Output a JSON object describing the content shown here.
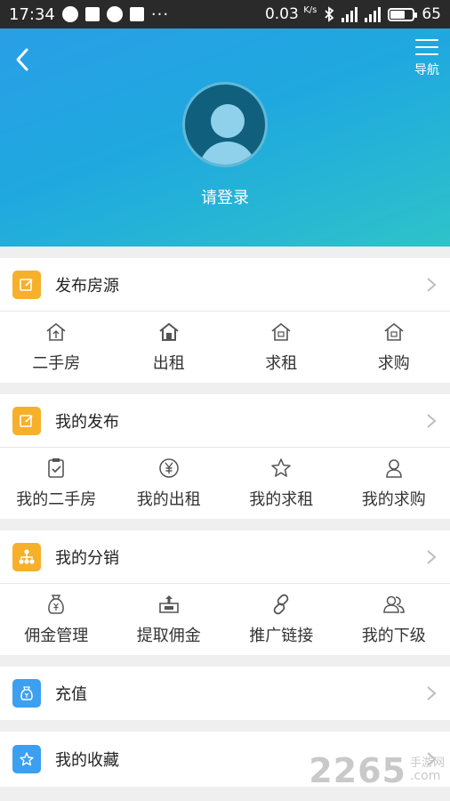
{
  "status_bar": {
    "time": "17:34",
    "speed": "0.03",
    "speed_unit": "K/s",
    "battery": "65",
    "dots": "···"
  },
  "header": {
    "nav_label": "导航",
    "login_label": "请登录"
  },
  "sections": {
    "publish": {
      "title": "发布房源",
      "items": [
        {
          "label": "二手房",
          "icon": "house-up-icon"
        },
        {
          "label": "出租",
          "icon": "house-rent-icon"
        },
        {
          "label": "求租",
          "icon": "house-seek-rent-icon"
        },
        {
          "label": "求购",
          "icon": "house-seek-buy-icon"
        }
      ]
    },
    "my_posts": {
      "title": "我的发布",
      "items": [
        {
          "label": "我的二手房",
          "icon": "clipboard-check-icon"
        },
        {
          "label": "我的出租",
          "icon": "yen-circle-icon"
        },
        {
          "label": "我的求租",
          "icon": "star-icon"
        },
        {
          "label": "我的求购",
          "icon": "person-icon"
        }
      ]
    },
    "distribution": {
      "title": "我的分销",
      "items": [
        {
          "label": "佣金管理",
          "icon": "money-bag-icon"
        },
        {
          "label": "提取佣金",
          "icon": "withdraw-icon"
        },
        {
          "label": "推广链接",
          "icon": "link-icon"
        },
        {
          "label": "我的下级",
          "icon": "users-icon"
        }
      ]
    },
    "recharge": {
      "title": "充值"
    },
    "favorites": {
      "title": "我的收藏"
    }
  },
  "watermark": {
    "number": "2265",
    "site_top": "手游网",
    "site_bottom": ".com"
  },
  "colors": {
    "accent_orange": "#f6b02a",
    "accent_blue": "#3c9ff0",
    "header_gradient_start": "#2a9fe6",
    "header_gradient_end": "#2ec3c9"
  }
}
